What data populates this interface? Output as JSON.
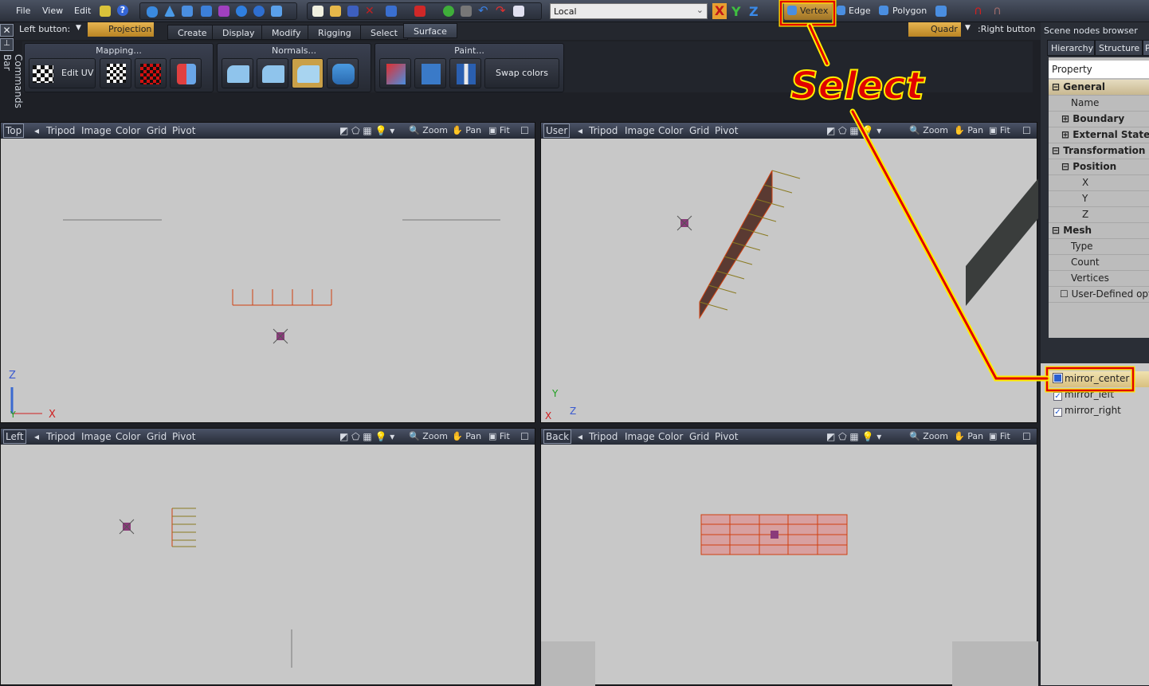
{
  "menu": [
    "File",
    "View",
    "Edit"
  ],
  "coord_system": "Local",
  "axes": [
    "X",
    "Y",
    "Z"
  ],
  "selection_modes": {
    "vertex": "Vertex",
    "edge": "Edge",
    "polygon": "Polygon"
  },
  "left_button": {
    "label": "Left button:",
    "value": "Projection"
  },
  "right_button": {
    "value": "Quadr",
    "label": ":Right button"
  },
  "tabs": [
    "Create",
    "Display",
    "Modify",
    "Rigging",
    "Select",
    "Surface"
  ],
  "active_tab": "Surface",
  "panels": {
    "mapping": "Mapping...",
    "edit_uv": "Edit UV",
    "normals": "Normals...",
    "paint": "Paint...",
    "swap_colors": "Swap colors"
  },
  "commands_bar": "Commands Bar",
  "viewport_menu": [
    "Tripod",
    "Image",
    "Color",
    "Grid",
    "Pivot"
  ],
  "viewport_tools": {
    "zoom": "Zoom",
    "pan": "Pan",
    "fit": "Fit"
  },
  "viewports": [
    "Top",
    "User",
    "Left",
    "Back"
  ],
  "axis_labels": {
    "top": [
      "Z",
      "Y",
      "X"
    ],
    "user": [
      "Y",
      "X",
      "Z"
    ]
  },
  "scene_browser": {
    "title": "Scene nodes browser",
    "tabs": [
      "Hierarchy",
      "Structure",
      "P"
    ],
    "header": "Property",
    "rows": [
      {
        "label": "General",
        "kind": "section"
      },
      {
        "label": "Name",
        "kind": "leaf"
      },
      {
        "label": "Boundary",
        "kind": "group"
      },
      {
        "label": "External State",
        "kind": "group"
      },
      {
        "label": "Transformation",
        "kind": "section"
      },
      {
        "label": "Position",
        "kind": "group"
      },
      {
        "label": "X",
        "kind": "leaf2"
      },
      {
        "label": "Y",
        "kind": "leaf2"
      },
      {
        "label": "Z",
        "kind": "leaf2"
      },
      {
        "label": "Mesh",
        "kind": "section"
      },
      {
        "label": "Type",
        "kind": "leaf"
      },
      {
        "label": "Count",
        "kind": "leaf"
      },
      {
        "label": "Vertices",
        "kind": "leaf"
      },
      {
        "label": "User-Defined options",
        "kind": "check"
      }
    ],
    "nodes": [
      {
        "name": "mirror_center",
        "checked": true,
        "selected": true
      },
      {
        "name": "mirror_left",
        "checked": true
      },
      {
        "name": "mirror_right",
        "checked": true
      }
    ]
  },
  "annotation": {
    "text": "Select",
    "color": "#ff0000",
    "outline": "#ffee00"
  }
}
